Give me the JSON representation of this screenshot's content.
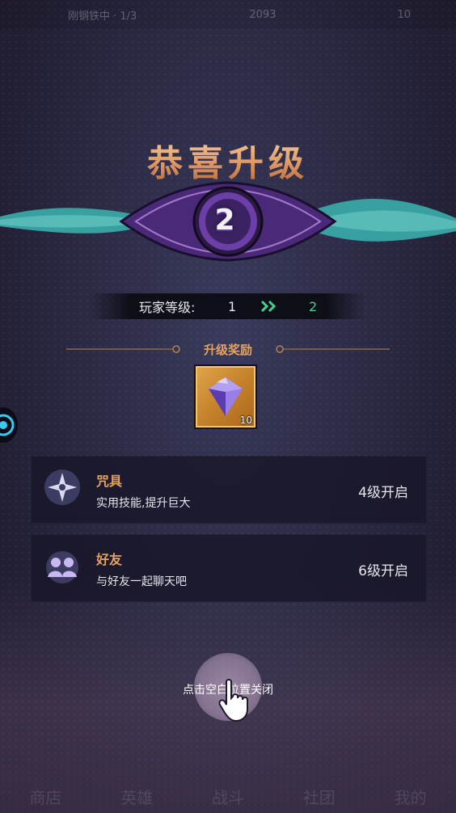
{
  "top_bar": {
    "label": "刚钢铁中 · 1/3",
    "coins": "2093",
    "energy": "10"
  },
  "title": "恭喜升级",
  "new_level": "2",
  "player_level": {
    "label": "玩家等级:",
    "old": "1",
    "new": "2"
  },
  "rewards": {
    "title": "升级奖励",
    "items": [
      {
        "icon": "diamond-icon",
        "count": "10"
      }
    ]
  },
  "features": [
    {
      "name": "咒具",
      "desc": "实用技能,提升巨大",
      "status": "4级开启",
      "icon": "shuriken-icon"
    },
    {
      "name": "好友",
      "desc": "与好友一起聊天吧",
      "status": "6级开启",
      "icon": "friends-icon"
    }
  ],
  "close_hint": "点击空白位置关闭",
  "bottom_nav": [
    "商店",
    "英雄",
    "战斗",
    "社团",
    "我的"
  ],
  "colors": {
    "accent_orange": "#e3a262",
    "level_green": "#3ed38c",
    "emblem_purple": "#6c3fa8",
    "wing_teal": "#3aa7a6"
  }
}
